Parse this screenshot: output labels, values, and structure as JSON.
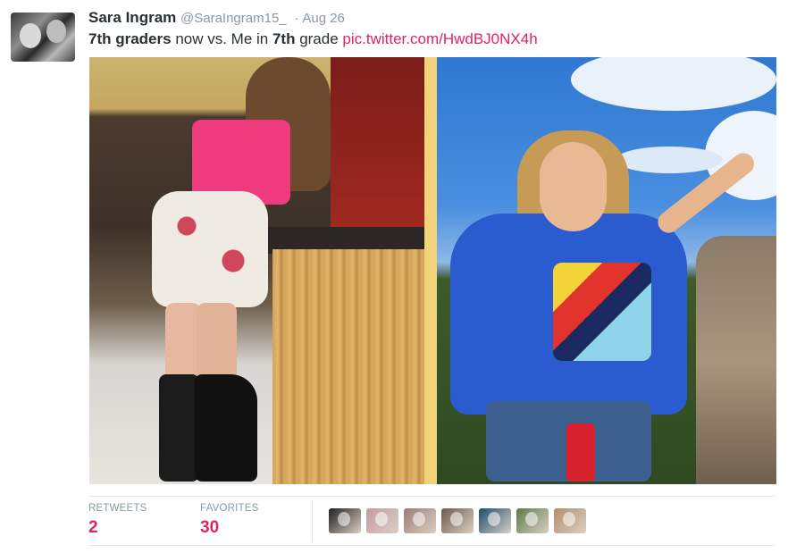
{
  "tweet": {
    "author_name": "Sara Ingram",
    "screen_name": "@SaraIngram15_",
    "separator": "·",
    "date": "Aug 26",
    "text_parts": [
      "7th graders",
      " now vs. Me in ",
      "7th",
      " grade "
    ],
    "link": "pic.twitter.com/HwdBJ0NX4h"
  },
  "stats": {
    "retweets_label": "RETWEETS",
    "retweets_count": "2",
    "favorites_label": "FAVORITES",
    "favorites_count": "30"
  },
  "favoriters": [
    {
      "name": "favoriter-avatar-1",
      "color": "#1f1f1f"
    },
    {
      "name": "favoriter-avatar-2",
      "color": "#c49aa4"
    },
    {
      "name": "favoriter-avatar-3",
      "color": "#9a7c73"
    },
    {
      "name": "favoriter-avatar-4",
      "color": "#6e5a4b"
    },
    {
      "name": "favoriter-avatar-5",
      "color": "#1e4d6b"
    },
    {
      "name": "favoriter-avatar-6",
      "color": "#5b7a4a"
    },
    {
      "name": "favoriter-avatar-7",
      "color": "#b58c6a"
    }
  ],
  "colors": {
    "link": "#e0245e",
    "count": "#e0245e",
    "muted": "#8899a6"
  }
}
